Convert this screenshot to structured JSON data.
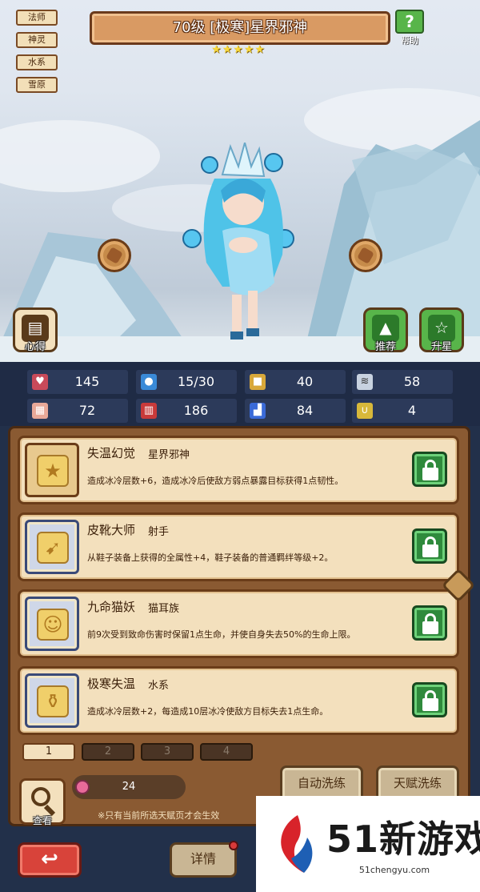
{
  "tags": [
    "法师",
    "神灵",
    "水系",
    "雪原"
  ],
  "header": {
    "title": "70级  [极寒]星界邪神",
    "stars": 5,
    "help_label": "帮助"
  },
  "scene_buttons": {
    "left": "心得",
    "recommend": "推荐",
    "upgrade": "升星"
  },
  "stats": [
    {
      "icon": "heart-icon",
      "value": "145"
    },
    {
      "icon": "water-drop-icon",
      "value": "15/30"
    },
    {
      "icon": "shield-icon",
      "value": "40"
    },
    {
      "icon": "wing-icon",
      "value": "58"
    },
    {
      "icon": "fist-icon",
      "value": "72"
    },
    {
      "icon": "book-icon",
      "value": "186"
    },
    {
      "icon": "boot-icon",
      "value": "84"
    },
    {
      "icon": "luck-icon",
      "value": "4"
    }
  ],
  "talents": [
    {
      "name": "失温幻觉",
      "category": "星界邪神",
      "desc": "造成冰冷层数+6，造成冰冷后使敌方弱点暴露目标获得1点韧性。",
      "icon": "star-icon"
    },
    {
      "name": "皮靴大师",
      "category": "射手",
      "desc": "从鞋子装备上获得的全属性+4，鞋子装备的普通羁绊等级+2。",
      "icon": "bow-icon"
    },
    {
      "name": "九命猫妖",
      "category": "猫耳族",
      "desc": "前9次受到致命伤害时保留1点生命，并使自身失去50%的生命上限。",
      "icon": "cat-icon"
    },
    {
      "name": "极寒失温",
      "category": "水系",
      "desc": "造成冰冷层数+2，每造成10层冰冷使敌方目标失去1点生命。",
      "icon": "flask-icon"
    }
  ],
  "pages": [
    "1",
    "2",
    "3",
    "4"
  ],
  "bottom": {
    "look_label": "查看",
    "cost_value": "24",
    "note": "※只有当前所选天赋页才会生效",
    "auto_refine": "自动洗练",
    "talent_refine": "天赋洗练",
    "back_symbol": "↩",
    "detail": "详情"
  },
  "watermark": {
    "brand": "51新游戏",
    "url": "51chengyu.com"
  },
  "colors": {
    "lock_green": "#2f8a3c",
    "card_bg": "#f3e0bd",
    "back_red": "#d8433a"
  }
}
